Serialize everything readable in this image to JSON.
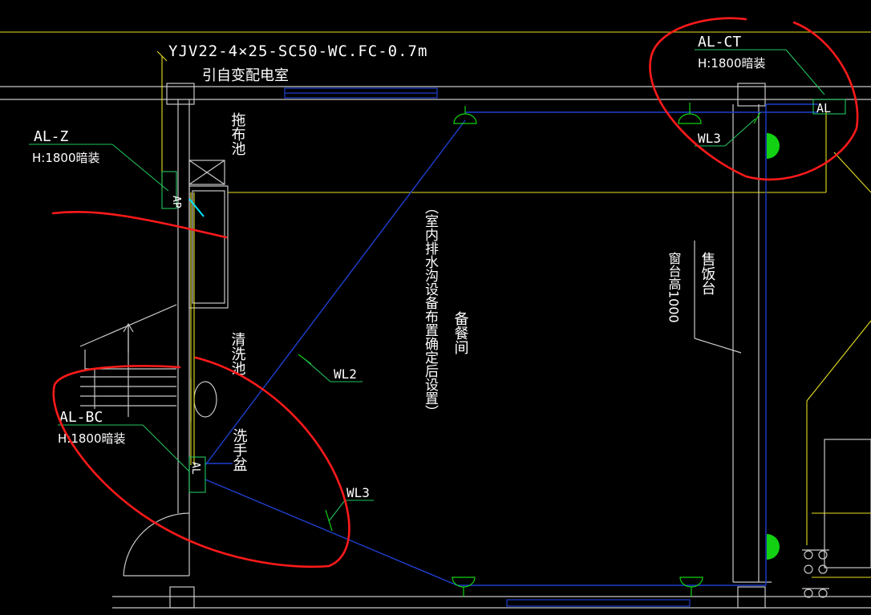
{
  "colors": {
    "background": "#000000",
    "wall": "#c8c8c8",
    "leader": "#22c55e",
    "wire": "#1e3fd0",
    "yellow": "#e8e020",
    "annotation": "#ff1a1a",
    "fixture": "#12d112",
    "text": "#ffffff"
  },
  "cable": {
    "spec": "YJV22-4×25-SC50-WC.FC-0.7m",
    "note": "引自变配电室"
  },
  "panels": {
    "al_z": {
      "name": "AL-Z",
      "mount": "H:1800暗装",
      "code": "AP"
    },
    "al_ct": {
      "name": "AL-CT",
      "mount": "H:1800暗装",
      "code": "AL"
    },
    "al_bc": {
      "name": "AL-BC",
      "mount": "H:1800暗装",
      "code": "AL"
    }
  },
  "circuits": {
    "wl2": "WL2",
    "wl3_top": "WL3",
    "wl3_bottom": "WL3"
  },
  "rooms": {
    "mop_pool": "拖布池",
    "wash_pool": "清洗池",
    "hand_basin": "洗手盆",
    "prep_room": "备餐间",
    "prep_note": "（室内排水沟设备布置确定后设置）",
    "counter": "售饭台",
    "window_sill": "窗台高1000"
  },
  "icons": {
    "ceiling_light": "ceiling-light-icon",
    "wall_light": "wall-light-icon",
    "stair_arrow": "up-arrow-icon"
  }
}
